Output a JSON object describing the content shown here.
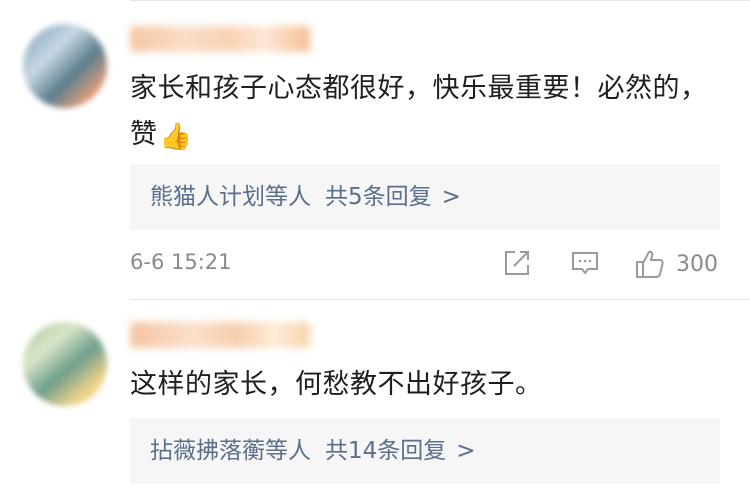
{
  "comments": [
    {
      "text": "家长和孩子心态都很好，快乐最重要！必然的，赞",
      "emoji": "👍",
      "emoji_icon": "thumbs-up-emoji",
      "replies": {
        "users": "熊猫人计划等人",
        "count": "共5条回复",
        "chevron": ">"
      },
      "time": "6-6 15:21",
      "likes": "300"
    },
    {
      "text": "这样的家长，何愁教不出好孩子。",
      "replies": {
        "users": "拈薇拂落蘅等人",
        "count": "共14条回复",
        "chevron": ">"
      }
    }
  ],
  "icons": {
    "share": "share-icon",
    "comment": "comment-icon",
    "like": "like-icon"
  },
  "colors": {
    "reply_link": "#5b6f8a",
    "meta_gray": "#8a8a8a",
    "reply_bg": "#f6f6f6"
  }
}
